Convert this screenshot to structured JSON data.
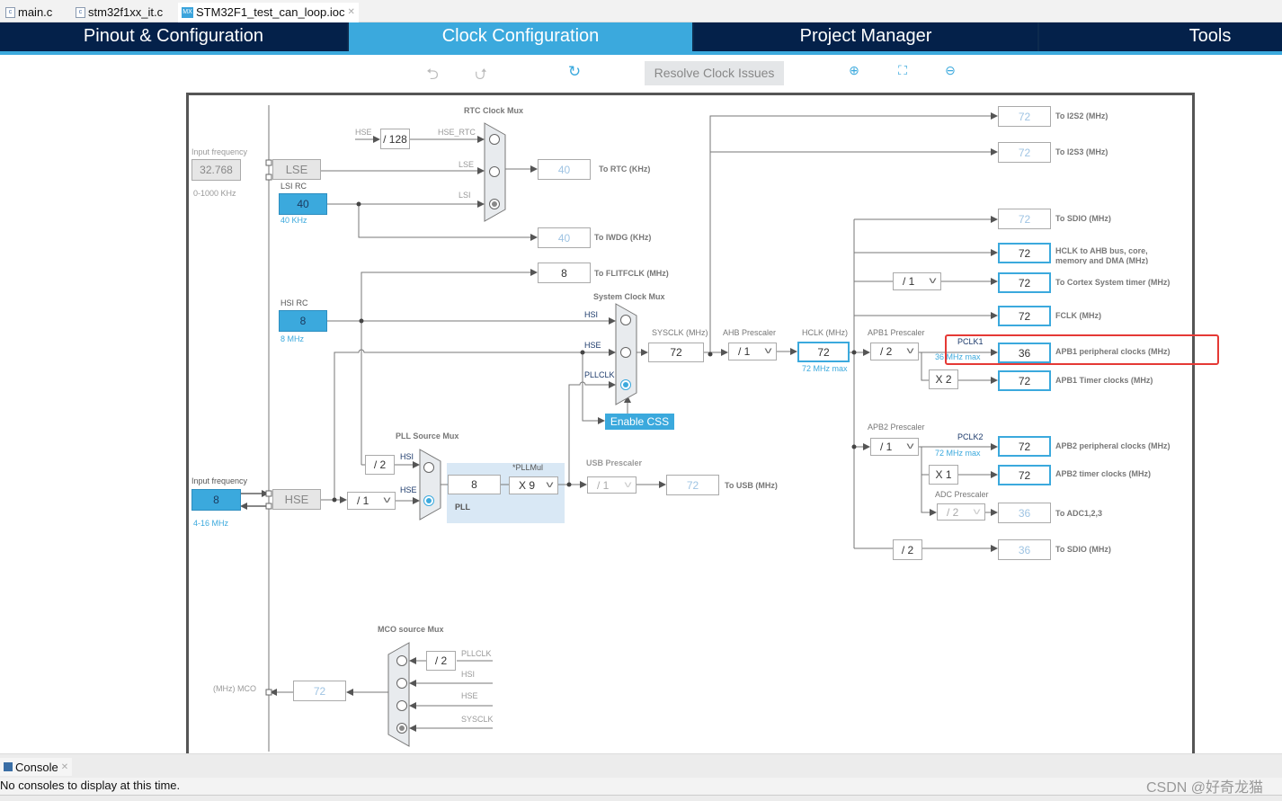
{
  "file_tabs": [
    {
      "label": "main.c",
      "icon": "c-file-icon"
    },
    {
      "label": "stm32f1xx_it.c",
      "icon": "c-file-icon"
    },
    {
      "label": "STM32F1_test_can_loop.ioc",
      "icon": "mx-file-icon"
    }
  ],
  "main_tabs": [
    "Pinout & Configuration",
    "Clock Configuration",
    "Project Manager",
    "Tools"
  ],
  "active_tab": "Clock Configuration",
  "toolbar": {
    "resolve": "Resolve Clock Issues"
  },
  "accent": "#3ba9dd",
  "diagram": {
    "lse_input": {
      "label": "Input frequency",
      "value": "32.768",
      "range": "0-1000 KHz"
    },
    "lse": "LSE",
    "lsi": {
      "label": "LSI RC",
      "value": "40",
      "unit": "40 KHz"
    },
    "hsi": {
      "label": "HSI RC",
      "value": "8",
      "unit": "8 MHz"
    },
    "hse_input": {
      "label": "Input frequency",
      "value": "8",
      "range": "4-16 MHz"
    },
    "hse": "HSE",
    "rtc_mux": {
      "title": "RTC Clock Mux",
      "hse": "HSE",
      "div": "/ 128",
      "hse_rtc": "HSE_RTC",
      "lse": "LSE",
      "lsi": "LSI",
      "selected": "LSI"
    },
    "rtc_out": {
      "value": "40",
      "label": "To RTC (KHz)"
    },
    "iwdg_out": {
      "value": "40",
      "label": "To IWDG (KHz)"
    },
    "flit_out": {
      "value": "8",
      "label": "To FLITFCLK (MHz)"
    },
    "sys_mux": {
      "title": "System Clock Mux",
      "hsi": "HSI",
      "hse": "HSE",
      "pllclk": "PLLCLK",
      "selected": "PLLCLK"
    },
    "enable_css": "Enable CSS",
    "pll_mux": {
      "title": "PLL Source Mux",
      "hsi_div": "/ 2",
      "hsi": "HSI",
      "hse": "HSE",
      "hse_div": "/ 1",
      "selected": "HSE"
    },
    "pll": {
      "input": "8",
      "mul_label": "*PLLMul",
      "mul": "X 9",
      "label": "PLL"
    },
    "usb": {
      "label": "USB Prescaler",
      "div": "/ 1",
      "value": "72",
      "out": "To USB (MHz)"
    },
    "sysclk": {
      "label": "SYSCLK (MHz)",
      "value": "72"
    },
    "ahb": {
      "label": "AHB Prescaler",
      "value": "/ 1"
    },
    "hclk": {
      "label": "HCLK (MHz)",
      "value": "72",
      "max": "72 MHz max"
    },
    "apb1": {
      "label": "APB1 Prescaler",
      "value": "/ 2",
      "pclk": "PCLK1",
      "max": "36 MHz max",
      "timer_mul": "X 2"
    },
    "apb2": {
      "label": "APB2 Prescaler",
      "value": "/ 1",
      "pclk": "PCLK2",
      "max": "72 MHz max",
      "timer_mul": "X 1"
    },
    "adc": {
      "label": "ADC Prescaler",
      "value": "/ 2"
    },
    "cortex_div": "/ 1",
    "sdio_div": "/ 2",
    "outputs": [
      {
        "value": "72",
        "label": "To I2S2 (MHz)"
      },
      {
        "value": "72",
        "label": "To I2S3 (MHz)"
      },
      {
        "value": "72",
        "label": "To SDIO (MHz)"
      },
      {
        "value": "72",
        "label": "HCLK to AHB bus, core, memory and DMA (MHz)"
      },
      {
        "value": "72",
        "label": "To Cortex System timer (MHz)"
      },
      {
        "value": "72",
        "label": "FCLK (MHz)"
      },
      {
        "value": "36",
        "label": "APB1 peripheral clocks (MHz)"
      },
      {
        "value": "72",
        "label": "APB1 Timer clocks (MHz)"
      },
      {
        "value": "72",
        "label": "APB2 peripheral clocks (MHz)"
      },
      {
        "value": "72",
        "label": "APB2 timer clocks (MHz)"
      },
      {
        "value": "36",
        "label": "To ADC1,2,3"
      },
      {
        "value": "36",
        "label": "To SDIO (MHz)"
      }
    ],
    "mco": {
      "title": "MCO source Mux",
      "div": "/ 2",
      "pllclk": "PLLCLK",
      "hsi": "HSI",
      "hse": "HSE",
      "sysclk": "SYSCLK",
      "value": "72",
      "label": "(MHz) MCO",
      "selected": "SYSCLK"
    },
    "highlight_color": "#e53935"
  },
  "console": {
    "tab": "Console",
    "message": "No consoles to display at this time."
  },
  "watermark": "CSDN @好奇龙猫"
}
